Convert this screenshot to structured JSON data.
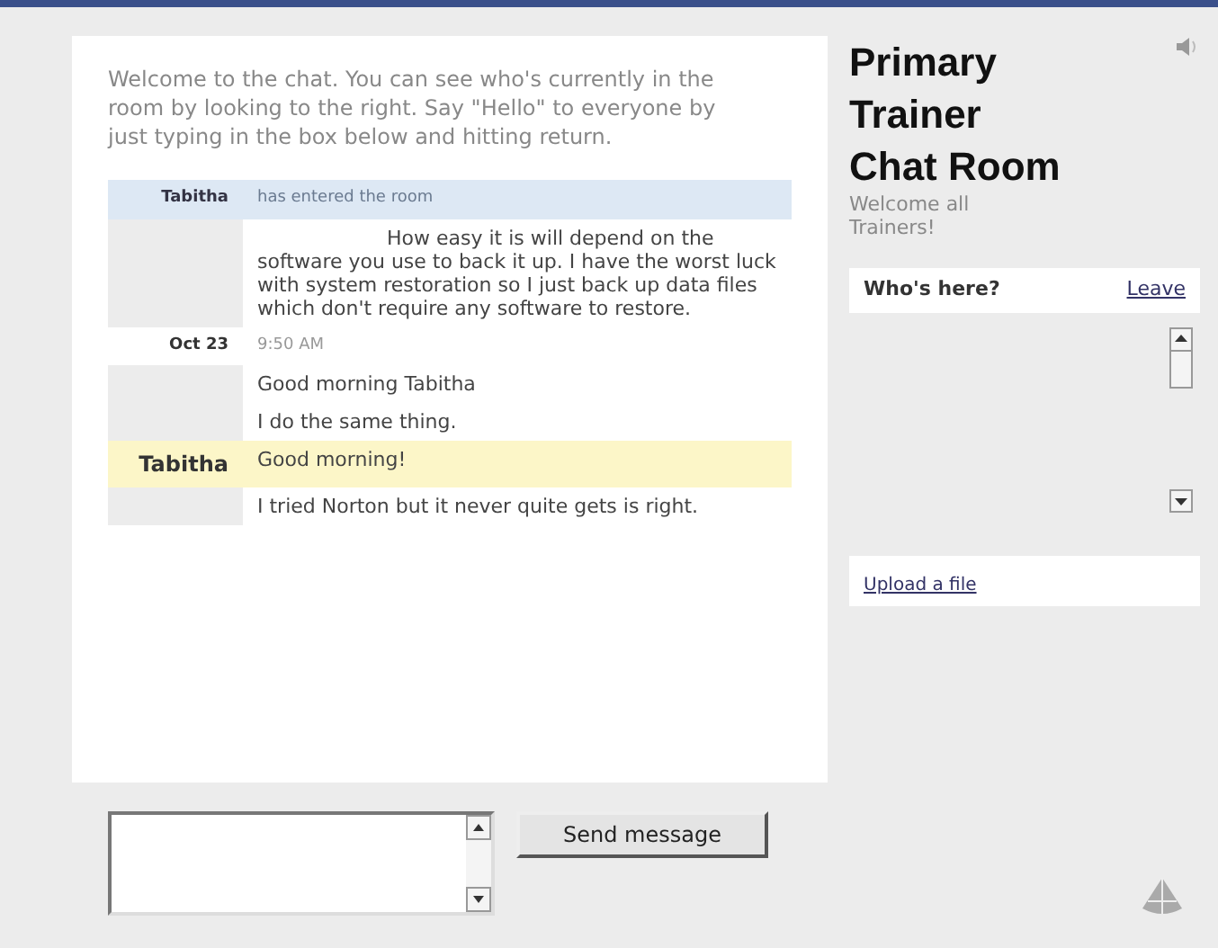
{
  "intro": "Welcome to the chat. You can see who's currently in the room by looking to the right. Say \"Hello\" to everyone by just typing in the box below and hitting return.",
  "messages": [
    {
      "kind": "system",
      "name": "Tabitha",
      "text": "has entered the room"
    },
    {
      "kind": "message",
      "text": "How easy it is will depend on the software you use to back it up. I have the worst luck with system restoration so I just back up data files which don't require any software to restore."
    },
    {
      "kind": "date",
      "name": "Oct 23",
      "text": "9:50 AM"
    },
    {
      "kind": "message",
      "text": "Good morning Tabitha"
    },
    {
      "kind": "message",
      "text": "I do the same thing."
    },
    {
      "kind": "highlight",
      "name": "Tabitha",
      "text": "Good morning!"
    },
    {
      "kind": "message",
      "text": "I tried Norton but it never quite gets is right."
    }
  ],
  "send_button": "Send message",
  "room": {
    "title": "Primary Trainer Chat Room",
    "subtitle": "Welcome all Trainers!"
  },
  "who": {
    "heading": "Who's here?",
    "leave": "Leave"
  },
  "upload": "Upload a file"
}
